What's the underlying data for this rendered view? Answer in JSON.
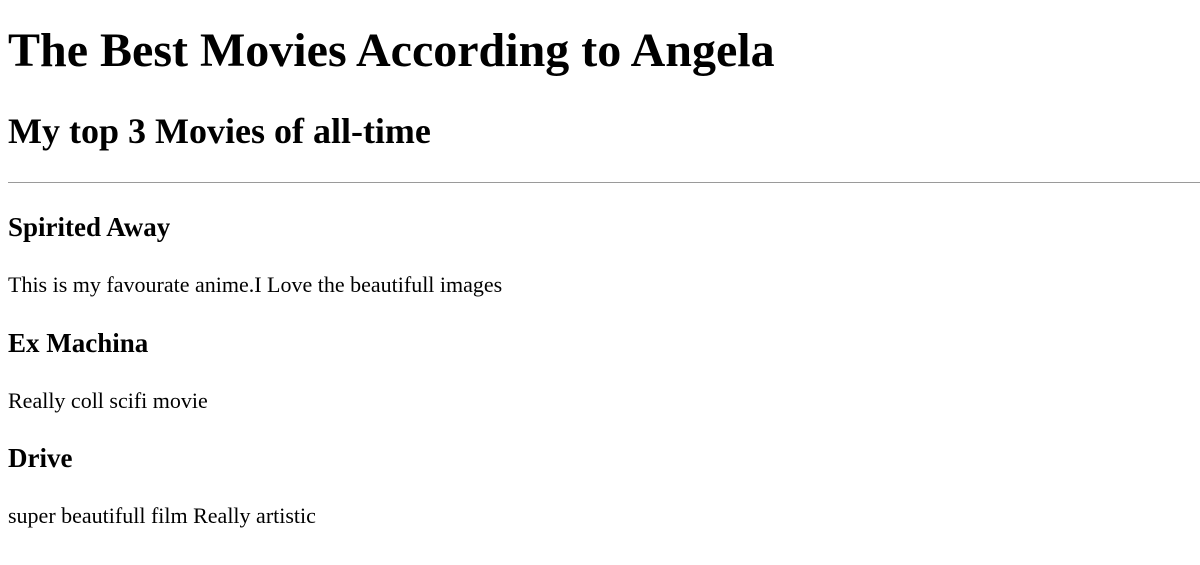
{
  "page": {
    "title": "The Best Movies According to Angela",
    "subtitle": "My top 3 Movies of all-time"
  },
  "movies": [
    {
      "title": "Spirited Away",
      "description": "This is my favourate anime.I Love the beautifull images"
    },
    {
      "title": "Ex Machina",
      "description": "Really coll scifi movie"
    },
    {
      "title": "Drive",
      "description": "super beautifull film Really artistic"
    }
  ]
}
